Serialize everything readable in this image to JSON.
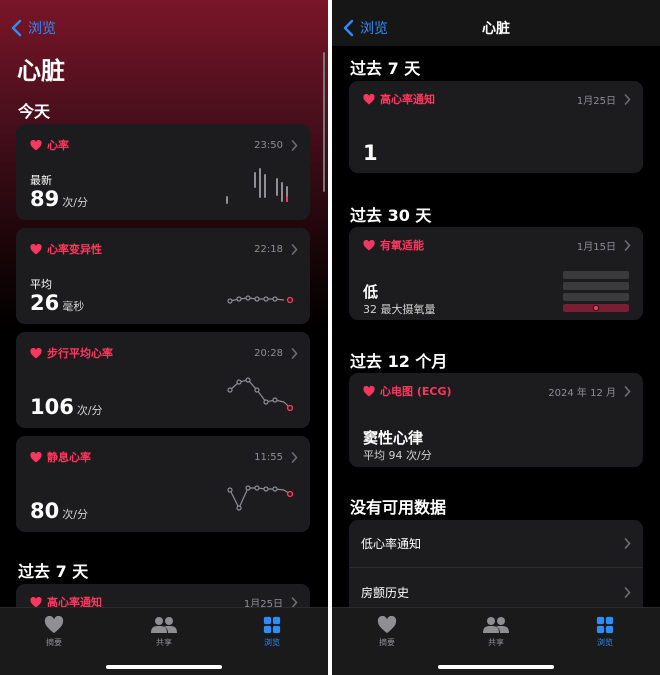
{
  "left": {
    "nav_back": "浏览",
    "title": "心脏",
    "today_section": "今天",
    "cards": [
      {
        "label": "心率",
        "time": "23:50",
        "sub": "最新",
        "value": "89",
        "unit": "次/分"
      },
      {
        "label": "心率变异性",
        "time": "22:18",
        "sub": "平均",
        "value": "26",
        "unit": "毫秒"
      },
      {
        "label": "步行平均心率",
        "time": "20:28",
        "sub": "",
        "value": "106",
        "unit": "次/分"
      },
      {
        "label": "静息心率",
        "time": "11:55",
        "sub": "",
        "value": "80",
        "unit": "次/分"
      }
    ],
    "past7_section": "过去 7 天",
    "past7_card": {
      "label": "高心率通知",
      "time": "1月25日"
    }
  },
  "right": {
    "nav_back": "浏览",
    "nav_title": "心脏",
    "past7_section": "过去 7 天",
    "high_hr": {
      "label": "高心率通知",
      "date": "1月25日",
      "value": "1"
    },
    "past30_section": "过去 30 天",
    "cardio": {
      "label": "有氧适能",
      "date": "1月15日",
      "value": "低",
      "sub": "32 最大摄氧量",
      "level": 0.5
    },
    "past12m_section": "过去 12 个月",
    "ecg": {
      "label": "心电图 (ECG)",
      "date": "2024 年 12 月",
      "value": "窦性心律",
      "sub": "平均 94 次/分"
    },
    "no_data_section": "没有可用数据",
    "no_data_items": [
      "低心率通知",
      "房颤历史"
    ]
  },
  "tabs": [
    {
      "label": "摘要",
      "icon": "heart-icon"
    },
    {
      "label": "共享",
      "icon": "people-icon"
    },
    {
      "label": "浏览",
      "icon": "grid-icon"
    }
  ],
  "colors": {
    "accent": "#ff375f",
    "link": "#2f8cff",
    "card": "#1c1c1e"
  }
}
